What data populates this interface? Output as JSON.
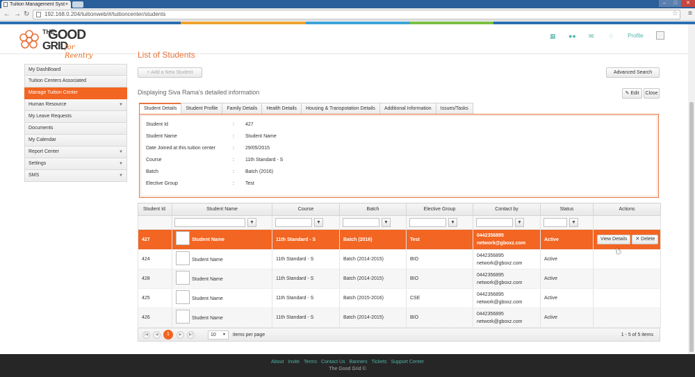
{
  "browser": {
    "tab_title": "Tuition Management Syst",
    "tab_close": "×",
    "url": "192.168.0.204/tuitionweb/#/tuitioncenter/students"
  },
  "brand": {
    "name_the": "THE",
    "name_good": "GOOD",
    "name_grid": "GRID",
    "tagline": "for Reentry"
  },
  "header": {
    "profile_label": "Profile"
  },
  "sidebar": {
    "items": [
      {
        "label": "My DashBoard"
      },
      {
        "label": "Tuition Centers Associated"
      },
      {
        "label": "Manage Tuition Center"
      },
      {
        "label": "Human Resource",
        "arrow": "▼"
      },
      {
        "label": "My Leave Requests"
      },
      {
        "label": "Documents"
      },
      {
        "label": "My Calendar"
      },
      {
        "label": "Report Center",
        "arrow": "▼"
      },
      {
        "label": "Settings",
        "arrow": "▼"
      },
      {
        "label": "SMS",
        "arrow": "▼"
      }
    ]
  },
  "main": {
    "title": "List of Students",
    "add_button": "+ Add a New Student",
    "advanced_search": "Advanced Search",
    "display_info": "Displaying Siva Rama's detailed information",
    "edit_button": "✎ Edit",
    "close_button": "Close"
  },
  "tabs": [
    "Student Details",
    "Student Profile",
    "Family Details",
    "Health Details",
    "Housing & Transpotation Details",
    "Additional Information",
    "Issues/Tasks"
  ],
  "details": [
    {
      "label": "Student Id",
      "value": "427"
    },
    {
      "label": "Student Name",
      "value": "Student Name"
    },
    {
      "label": "Date Joined at this tuition center",
      "value": "29/05/2015"
    },
    {
      "label": "Course",
      "value": "11th Standard - S"
    },
    {
      "label": "Batch",
      "value": "Batch (2016)"
    },
    {
      "label": "Elective Group",
      "value": "Test"
    }
  ],
  "details_colon": ":",
  "grid": {
    "columns": [
      "Student Id",
      "Student Name",
      "Course",
      "Batch",
      "Elective Group",
      "Contact by",
      "Status",
      "Actions"
    ],
    "rows": [
      {
        "id": "427",
        "name": "Student Name",
        "course": "11th Standard - S",
        "batch": "Batch (2016)",
        "group": "Test",
        "phone": "0442356895",
        "email": "network@gboxz.com",
        "status": "Active"
      },
      {
        "id": "424",
        "name": "Student Name",
        "course": "11th Standard - S",
        "batch": "Batch (2014-2015)",
        "group": "BIO",
        "phone": "0442356895",
        "email": "network@gboxz.com",
        "status": "Active"
      },
      {
        "id": "428",
        "name": "Student Name",
        "course": "11th Standard - S",
        "batch": "Batch (2014-2015)",
        "group": "BIO",
        "phone": "0442356895",
        "email": "network@gboxz.com",
        "status": "Active"
      },
      {
        "id": "425",
        "name": "Student Name",
        "course": "11th Standard - S",
        "batch": "Batch (2015-2016)",
        "group": "CSE",
        "phone": "0442356895",
        "email": "network@gboxz.com",
        "status": "Active"
      },
      {
        "id": "426",
        "name": "Student Name",
        "course": "11th Standard - S",
        "batch": "Batch (2014-2015)",
        "group": "BIO",
        "phone": "0442356895",
        "email": "network@gboxz.com",
        "status": "Active"
      }
    ],
    "view_details": "View Details",
    "delete": "✕ Delete"
  },
  "pager": {
    "current_page": "1",
    "page_size": "10",
    "items_per_page_label": "items per page",
    "summary": "1 - 5 of 5 items"
  },
  "footer": {
    "links": [
      "About",
      "Invite",
      "Terms",
      "Contact Us",
      "Banners",
      "Tickets",
      "Support Center"
    ],
    "copyright": "The Good Grid ©"
  },
  "colors": {
    "accent": "#f26522",
    "teal": "#4fb3a8",
    "footer_bg": "#262626"
  }
}
